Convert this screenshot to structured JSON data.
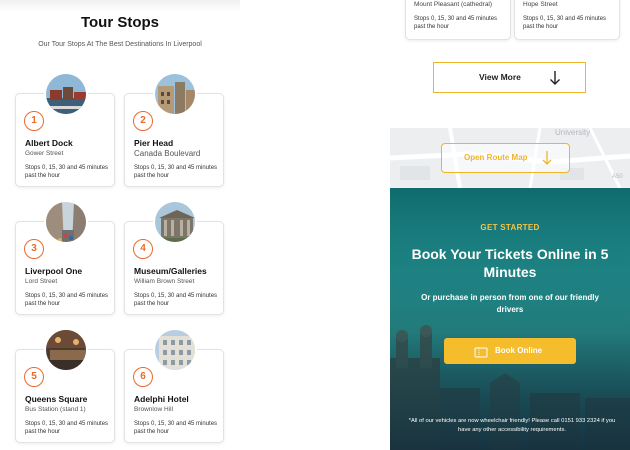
{
  "tour": {
    "title": "Tour Stops",
    "subtitle": "Our Tour Stops At The Best Destinations In Liverpool"
  },
  "stops": [
    {
      "number": "1",
      "name": "Albert Dock",
      "street": "Gower Street",
      "times": "Stops 0, 15, 30 and 45 minutes past the hour",
      "photo_icon": "albert-dock-photo"
    },
    {
      "number": "2",
      "name": "Pier Head",
      "street": "Canada Boulevard",
      "times": "Stops 0, 15, 30 and 45 minutes past the hour",
      "photo_icon": "pier-head-photo"
    },
    {
      "number": "3",
      "name": "Liverpool One",
      "street": "Lord Street",
      "times": "Stops 0, 15, 30 and 45 minutes past the hour",
      "photo_icon": "liverpool-one-photo"
    },
    {
      "number": "4",
      "name": "Museum/Galleries",
      "street": "William Brown Street",
      "times": "Stops 0, 15, 30 and 45 minutes past the hour",
      "photo_icon": "museum-galleries-photo"
    },
    {
      "number": "5",
      "name": "Queens Square",
      "street": "Bus Station (stand 1)",
      "times": "Stops 0, 15, 30 and 45 minutes past the hour",
      "photo_icon": "queens-square-photo"
    },
    {
      "number": "6",
      "name": "Adelphi Hotel",
      "street": "Brownlow Hill",
      "times": "Stops 0, 15, 30 and 45 minutes past the hour",
      "photo_icon": "adelphi-hotel-photo"
    }
  ],
  "more_stops": [
    {
      "street": "Mount Pleasant (cathedral)",
      "times": "Stops 0, 15, 30 and 45 minutes past the hour"
    },
    {
      "street": "Hope Street",
      "times": "Stops 0, 15, 30 and 45 minutes past the hour"
    }
  ],
  "view_more": {
    "label": "View More",
    "icon": "arrow-down-icon"
  },
  "map": {
    "route_button": "Open Route Map",
    "labels": {
      "university": "University",
      "road": "A50"
    }
  },
  "hero": {
    "kicker": "GET STARTED",
    "title": "Book Your Tickets Online in 5 Minutes",
    "subtitle": "Or purchase in person from one of our friendly drivers",
    "button": "Book Online",
    "button_icon": "ticket-icon",
    "note": "*All of our vehicles are now wheelchair friendly! Please call 0151 933 2324 if you have any other accessibility requirements."
  },
  "colors": {
    "accent_orange": "#ea6b2c",
    "accent_yellow": "#f0b429",
    "hero_teal": "#1f8a8a"
  }
}
